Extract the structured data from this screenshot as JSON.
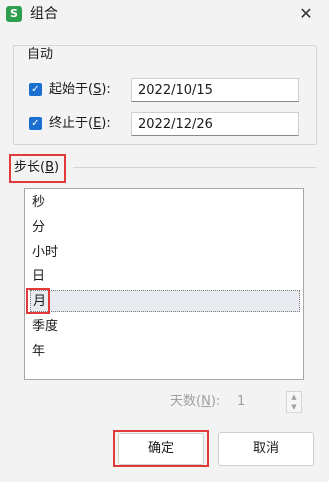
{
  "window": {
    "app_icon": "S",
    "title": "组合",
    "close_symbol": "✕"
  },
  "auto": {
    "title": "自动",
    "start": {
      "checked": true,
      "label_prefix": "起始于(",
      "label_key": "S",
      "label_suffix": "):",
      "value": "2022/10/15"
    },
    "end": {
      "checked": true,
      "label_prefix": "终止于(",
      "label_key": "E",
      "label_suffix": "):",
      "value": "2022/12/26"
    }
  },
  "step": {
    "label_prefix": "步长(",
    "label_key": "B",
    "label_suffix": ")",
    "items": [
      {
        "label": "秒",
        "selected": false
      },
      {
        "label": "分",
        "selected": false
      },
      {
        "label": "小时",
        "selected": false
      },
      {
        "label": "日",
        "selected": false
      },
      {
        "label": "月",
        "selected": true
      },
      {
        "label": "季度",
        "selected": false
      },
      {
        "label": "年",
        "selected": false
      }
    ]
  },
  "days": {
    "label_prefix": "天数(",
    "label_key": "N",
    "label_suffix": "):",
    "value": "1"
  },
  "buttons": {
    "ok": "确定",
    "cancel": "取消"
  },
  "colors": {
    "checkbox": "#1a6fd1",
    "highlight": "#e03a3a",
    "app_icon": "#2f9e4f"
  }
}
